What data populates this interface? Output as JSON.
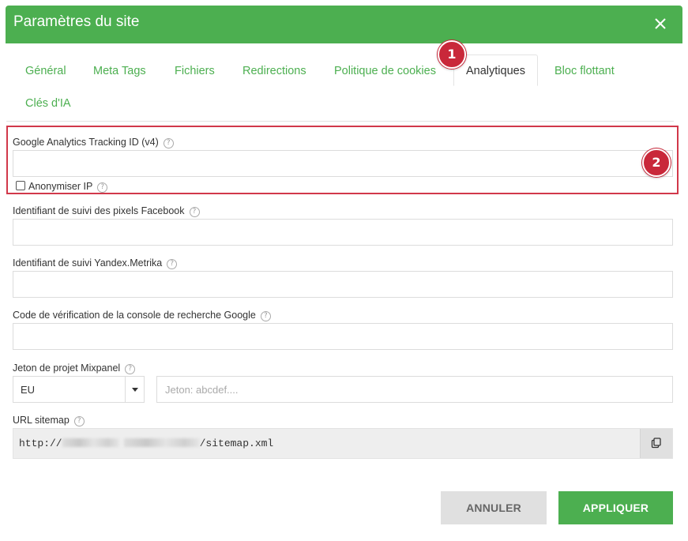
{
  "dialog": {
    "title": "Paramètres du site"
  },
  "tabs": [
    {
      "label": "Général"
    },
    {
      "label": "Meta Tags"
    },
    {
      "label": "Fichiers"
    },
    {
      "label": "Redirections"
    },
    {
      "label": "Politique de cookies"
    },
    {
      "label": "Analytiques",
      "active": true
    },
    {
      "label": "Bloc flottant"
    },
    {
      "label": "Clés d'IA"
    }
  ],
  "badges": {
    "step1": "1",
    "step2": "2"
  },
  "form": {
    "ga": {
      "label": "Google Analytics Tracking ID (v4)",
      "value": "",
      "anonymize_label": "Anonymiser IP"
    },
    "facebook": {
      "label": "Identifiant de suivi des pixels Facebook",
      "value": ""
    },
    "yandex": {
      "label": "Identifiant de suivi Yandex.Metrika",
      "value": ""
    },
    "google_console": {
      "label": "Code de vérification de la console de recherche Google",
      "value": ""
    },
    "mixpanel": {
      "label": "Jeton de projet Mixpanel",
      "region": "EU",
      "token_placeholder": "Jeton: abcdef...."
    },
    "sitemap": {
      "label": "URL sitemap",
      "url_prefix": "http://",
      "url_suffix": "/sitemap.xml"
    }
  },
  "buttons": {
    "cancel": "ANNULER",
    "apply": "APPLIQUER"
  },
  "colors": {
    "accent": "#4caf50",
    "badge": "#c9283a",
    "highlight": "#d1384a"
  }
}
